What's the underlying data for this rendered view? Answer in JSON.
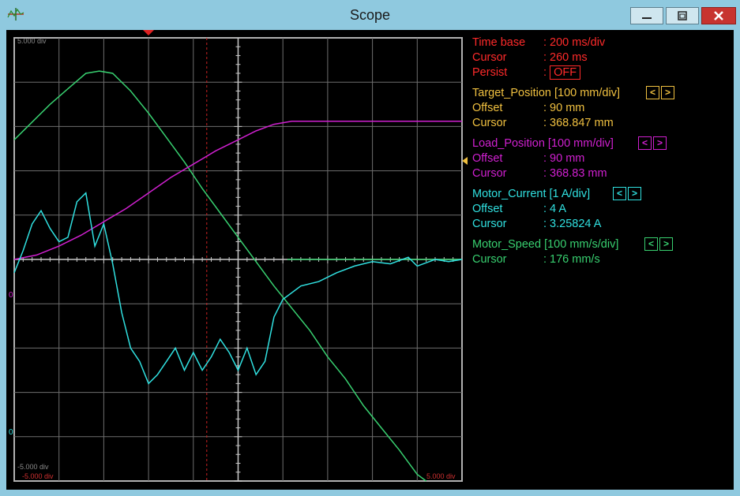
{
  "window": {
    "title": "Scope",
    "controls": {
      "minimize": "minimize-icon",
      "maximize": "maximize-icon",
      "close": "close-icon"
    }
  },
  "plot": {
    "top_left_label": "5.000 div",
    "bottom_left_label": "-5.000 div",
    "x_min_label": "-5.000 div",
    "x_max_label": "5.000 div",
    "left_marker_1": "0",
    "left_marker_2": "0",
    "colors": {
      "grid": "#6e6e6e",
      "axis": "#c8c8c8",
      "cursor": "#cc2222",
      "target": "#38d070",
      "load": "#d020d0",
      "current": "#30e0e0",
      "speed": "#38d070"
    }
  },
  "chart_data": {
    "type": "line",
    "xlim": [
      -5,
      5
    ],
    "ylim": [
      -5,
      5
    ],
    "cursor_x": -0.7,
    "series": [
      {
        "name": "Target_Position",
        "values_y": [
          2.7,
          3.1,
          3.5,
          3.85,
          4.2,
          4.25,
          4.2,
          3.8,
          3.3,
          2.75,
          2.2,
          1.6,
          1.05,
          0.5,
          -0.05,
          -0.6,
          -1.1,
          -1.6,
          -2.2,
          -2.7,
          -3.3,
          -3.8,
          -4.3,
          -4.85,
          -5.0
        ],
        "x": [
          -5,
          -4.6,
          -4.2,
          -3.8,
          -3.4,
          -3.1,
          -2.8,
          -2.4,
          -2.0,
          -1.6,
          -1.2,
          -0.8,
          -0.4,
          0.0,
          0.4,
          0.8,
          1.2,
          1.6,
          2.0,
          2.4,
          2.8,
          3.2,
          3.6,
          4.0,
          4.2
        ]
      },
      {
        "name": "Motor_Speed",
        "values_y": [
          0,
          0,
          0,
          0,
          0,
          0,
          0,
          0,
          0,
          0
        ],
        "x": [
          1.1,
          1.5,
          2.0,
          2.5,
          3.0,
          3.5,
          4.0,
          4.5,
          5.0,
          5.0
        ]
      },
      {
        "name": "Load_Position",
        "values_y": [
          0.0,
          0.1,
          0.3,
          0.55,
          0.85,
          1.15,
          1.5,
          1.85,
          2.15,
          2.45,
          2.7,
          2.9,
          3.05,
          3.12,
          3.12,
          3.12
        ],
        "x": [
          -5,
          -4.5,
          -4.0,
          -3.5,
          -3.0,
          -2.5,
          -2.0,
          -1.5,
          -1.0,
          -0.5,
          0.0,
          0.4,
          0.8,
          1.2,
          3.0,
          5.0
        ]
      },
      {
        "name": "Motor_Current",
        "values_y": [
          -0.3,
          0.2,
          0.8,
          1.1,
          0.7,
          0.4,
          0.5,
          1.3,
          1.5,
          0.3,
          0.8,
          -0.1,
          -1.2,
          -2.0,
          -2.3,
          -2.8,
          -2.6,
          -2.3,
          -2.0,
          -2.5,
          -2.1,
          -2.5,
          -2.2,
          -1.8,
          -2.1,
          -2.5,
          -2.0,
          -2.6,
          -2.3,
          -1.3,
          -0.9,
          -0.6,
          -0.5,
          -0.3,
          -0.15,
          -0.05,
          -0.1,
          0.05,
          -0.15,
          0.0,
          -0.05,
          0.0
        ],
        "x": [
          -5,
          -4.8,
          -4.6,
          -4.4,
          -4.2,
          -4.0,
          -3.8,
          -3.6,
          -3.4,
          -3.2,
          -3.0,
          -2.8,
          -2.6,
          -2.4,
          -2.2,
          -2.0,
          -1.8,
          -1.6,
          -1.4,
          -1.2,
          -1.0,
          -0.8,
          -0.6,
          -0.4,
          -0.2,
          0.0,
          0.2,
          0.4,
          0.6,
          0.8,
          1.0,
          1.4,
          1.8,
          2.2,
          2.6,
          3.0,
          3.4,
          3.8,
          4.0,
          4.4,
          4.7,
          5.0
        ]
      }
    ]
  },
  "info": {
    "timebase_label": "Time base",
    "timebase_value": ": 200 ms/div",
    "cursor_label": "Cursor",
    "cursor_value": ": 260 ms",
    "persist_label": "Persist",
    "persist_sep": ":",
    "persist_value": "OFF",
    "target": {
      "title": "Target_Position [100 mm/div]",
      "offset_label": "Offset",
      "offset_value": ": 90 mm",
      "cursor_label": "Cursor",
      "cursor_value": ": 368.847 mm"
    },
    "load": {
      "title": "Load_Position [100 mm/div]",
      "offset_label": "Offset",
      "offset_value": ": 90 mm",
      "cursor_label": "Cursor",
      "cursor_value": ": 368.83 mm"
    },
    "current": {
      "title": "Motor_Current [1 A/div]",
      "offset_label": "Offset",
      "offset_value": ": 4 A",
      "cursor_label": "Cursor",
      "cursor_value": ": 3.25824 A"
    },
    "speed": {
      "title": "Motor_Speed [100 mm/s/div]",
      "cursor_label": "Cursor",
      "cursor_value": ": 176 mm/s"
    },
    "arrow_left": "<",
    "arrow_right": ">"
  }
}
